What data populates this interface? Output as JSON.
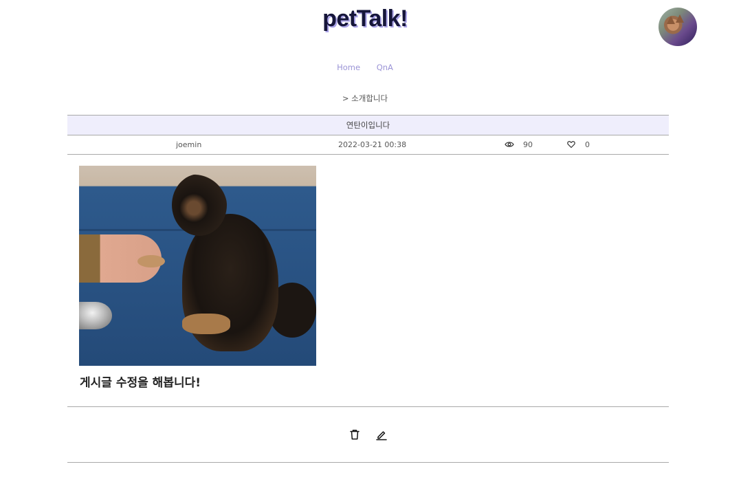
{
  "header": {
    "logo_text": "petTalk!",
    "profile": {
      "icon": "user-avatar"
    }
  },
  "nav": {
    "items": [
      {
        "label": "Home"
      },
      {
        "label": "QnA"
      }
    ]
  },
  "breadcrumb": {
    "text": "> 소개합니다"
  },
  "post": {
    "title": "연탄이입니다",
    "author": "joemin",
    "date": "2022-03-21 00:38",
    "views": "90",
    "likes": "0",
    "image_icon": "dog-photo",
    "body": "게시글 수정을 해봅니다!"
  },
  "actions": {
    "delete_icon": "trash-icon",
    "edit_icon": "pencil-icon"
  },
  "colors": {
    "logo_shadow": "#a9a2e6",
    "nav_link": "#9b94d6",
    "title_bar_bg": "#efeefc",
    "divider": "#a8a8a8"
  }
}
